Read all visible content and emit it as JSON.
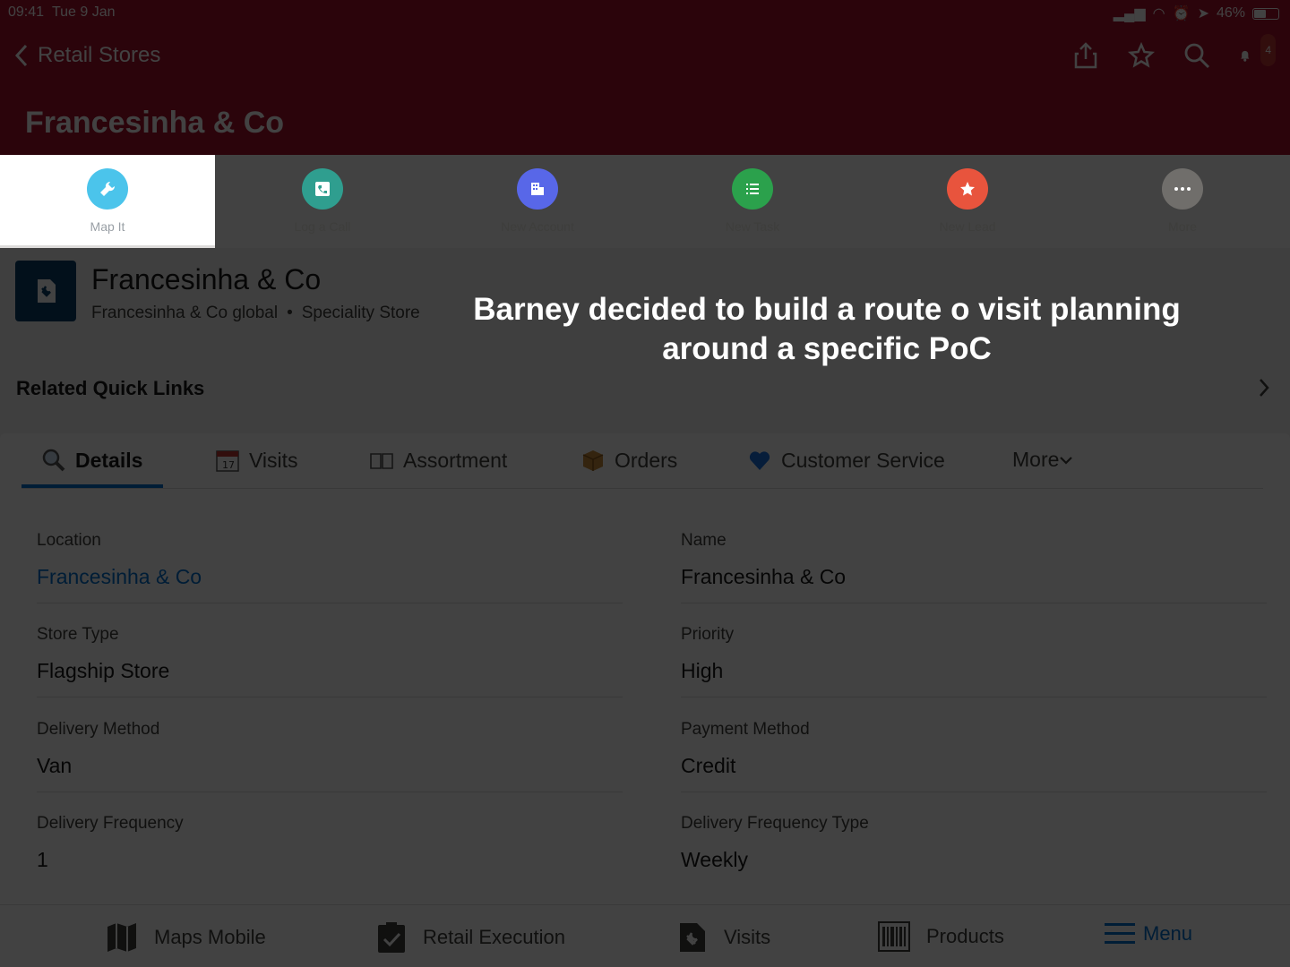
{
  "status_bar": {
    "time": "09:41",
    "date": "Tue 9 Jan",
    "battery": "46%"
  },
  "header": {
    "back_label": "Retail Stores",
    "title": "Francesinha & Co",
    "icons": [
      "share-icon",
      "star-icon",
      "search-icon",
      "bell-icon"
    ],
    "notification_count": "4",
    "color": "#a8102d"
  },
  "actions": [
    {
      "label": "Map It",
      "color": "#4bc4eb",
      "icon": "wrench-icon"
    },
    {
      "label": "Log a Call",
      "color": "#2f9e8f",
      "icon": "phone-icon"
    },
    {
      "label": "New Account",
      "color": "#5867e8",
      "icon": "building-icon"
    },
    {
      "label": "New Task",
      "color": "#2ba14c",
      "icon": "list-icon"
    },
    {
      "label": "New Lead",
      "color": "#e8543d",
      "icon": "star-icon"
    },
    {
      "label": "More",
      "color": "#706e6b",
      "icon": "more-icon"
    }
  ],
  "record": {
    "name": "Francesinha & Co",
    "subtitle_1": "Francesinha & Co global",
    "separator": "•",
    "subtitle_2": "Speciality Store"
  },
  "quick_links": {
    "title": "Related Quick Links"
  },
  "tabs": [
    "Details",
    "Visits",
    "Assortment",
    "Orders",
    "Customer Service",
    "More"
  ],
  "fields": [
    {
      "label": "Location",
      "value": "Francesinha & Co"
    },
    {
      "label": "Name",
      "value": "Francesinha & Co"
    },
    {
      "label": "Store Type",
      "value": "Flagship Store"
    },
    {
      "label": "Priority",
      "value": "High"
    },
    {
      "label": "Delivery Method",
      "value": "Van"
    },
    {
      "label": "Payment Method",
      "value": "Credit"
    },
    {
      "label": "Delivery Frequency",
      "value": "1"
    },
    {
      "label": "Delivery Frequency Type",
      "value": "Weekly"
    }
  ],
  "bottom_tabs": [
    "Maps Mobile",
    "Retail Execution",
    "Visits",
    "Products",
    "Menu"
  ],
  "caption": "Barney decided to build a route o visit planning around a specific PoC"
}
